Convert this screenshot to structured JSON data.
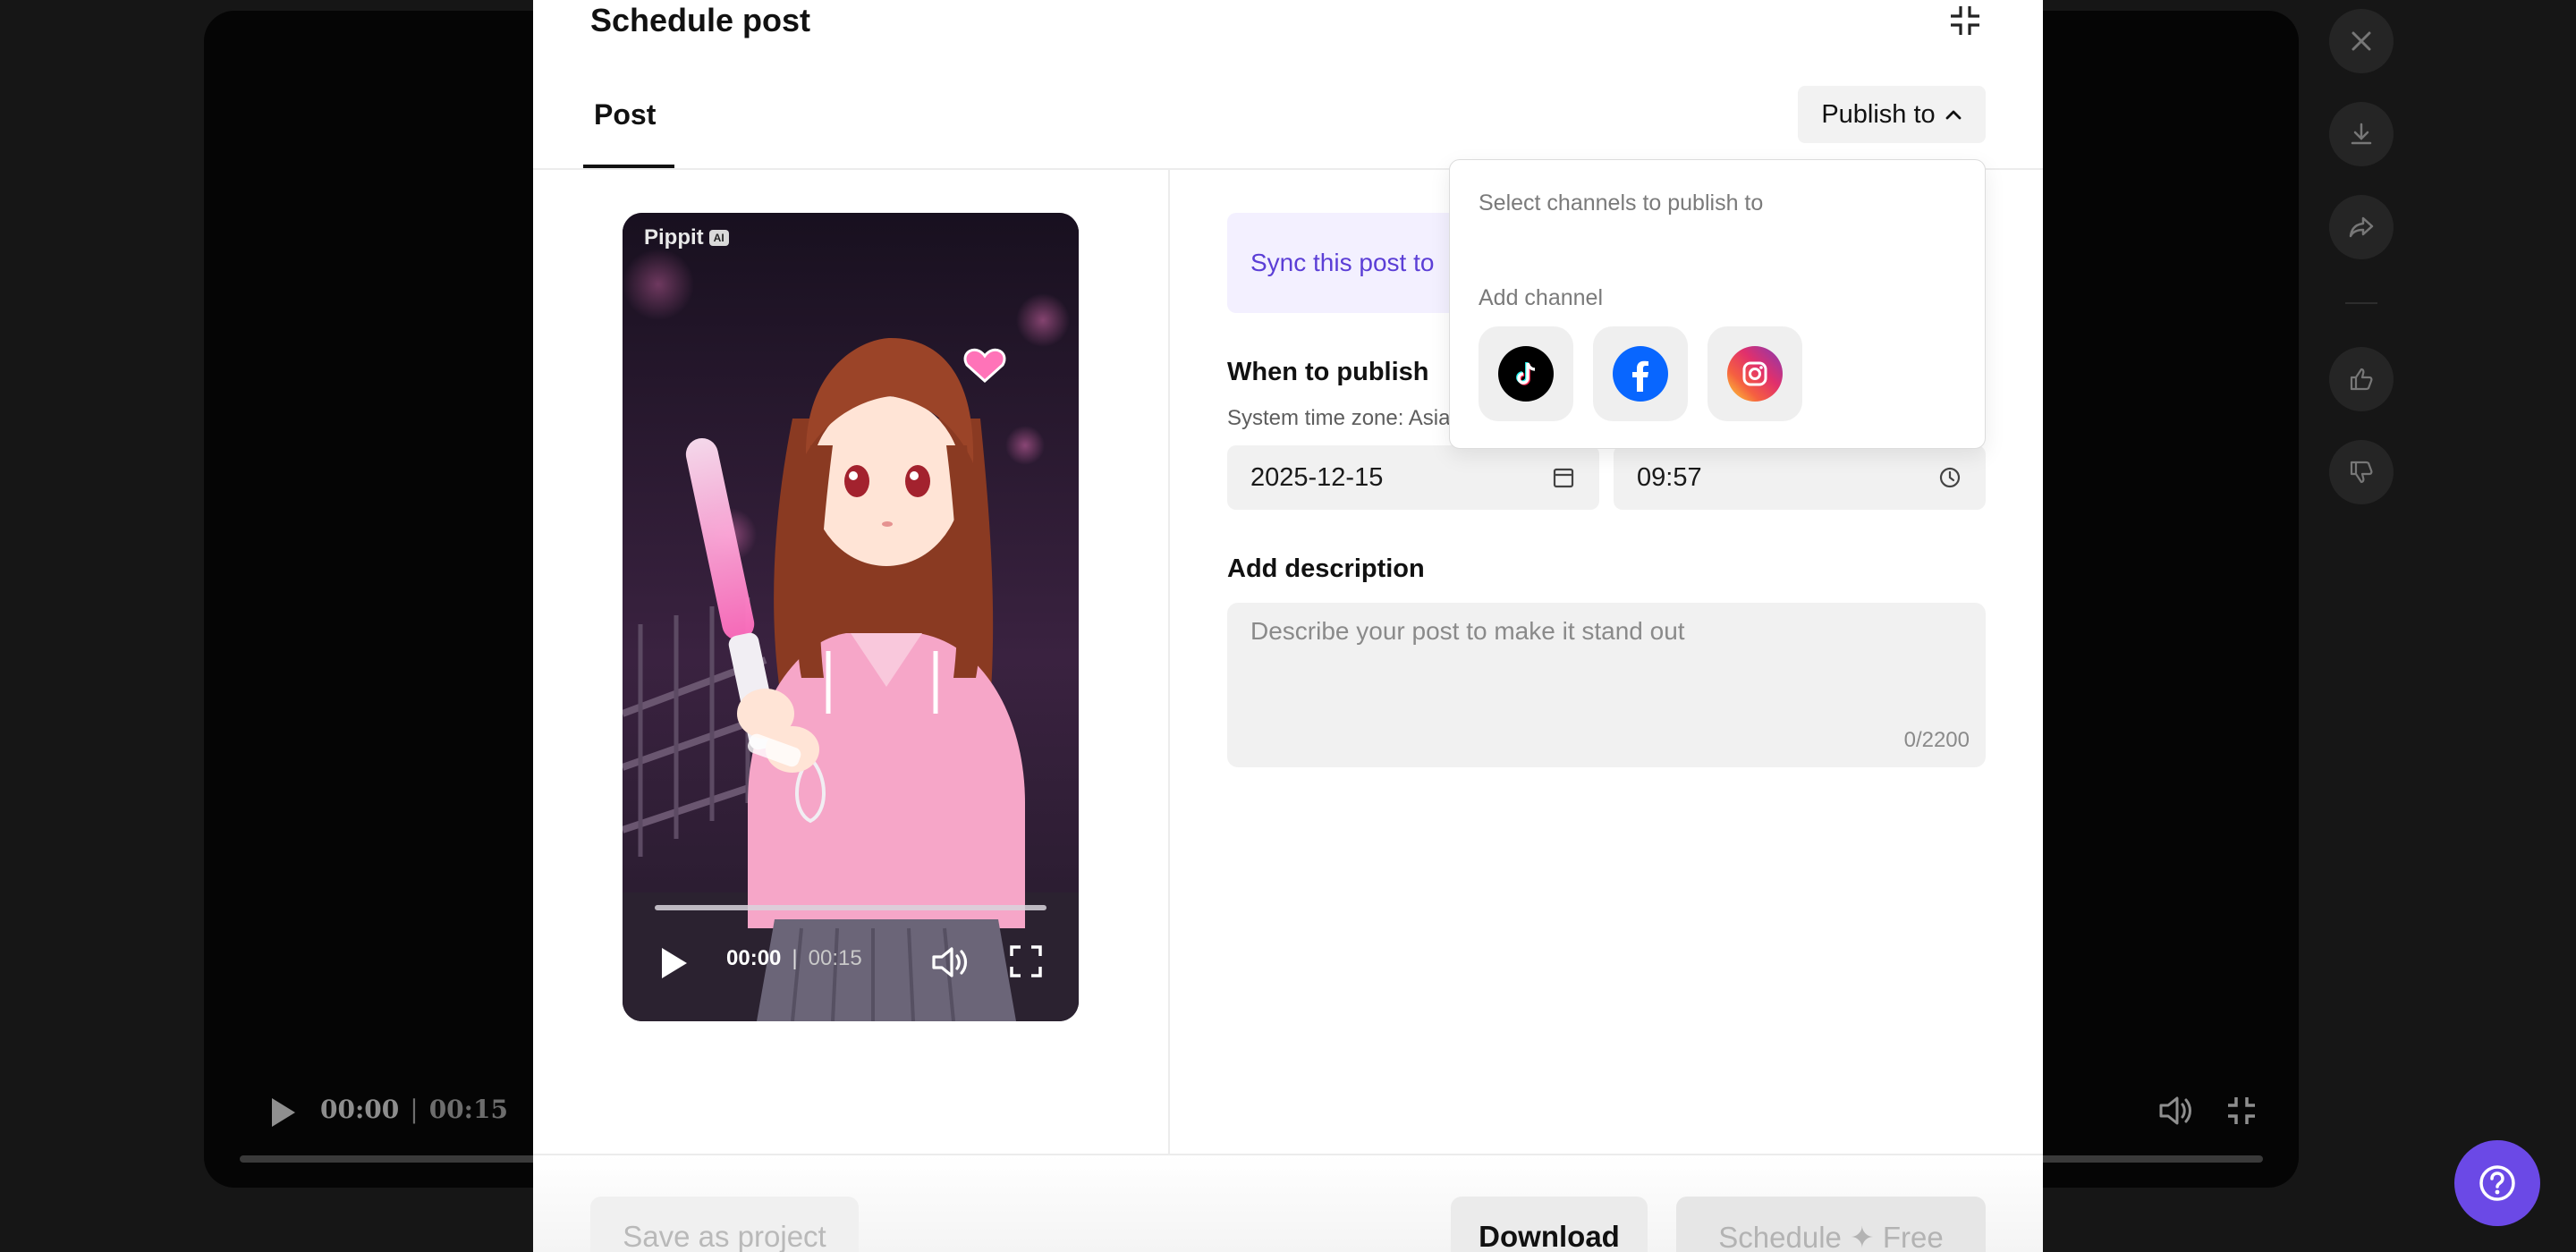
{
  "background_player": {
    "current_time": "00:00",
    "separator": "|",
    "duration": "00:15"
  },
  "modal": {
    "title": "Schedule post",
    "tabs": [
      {
        "label": "Post"
      }
    ],
    "publish_to_label": "Publish to",
    "video": {
      "watermark": "Pippit",
      "watermark_badge": "AI",
      "current_time": "00:00",
      "separator": "|",
      "duration": "00:15",
      "progress_fraction": 0
    },
    "sync_banner": "Sync this post to",
    "when_to_publish": {
      "label": "When to publish",
      "timezone_label": "System time zone: Asia",
      "date": "2025-12-15",
      "time": "09:57"
    },
    "description": {
      "label": "Add description",
      "placeholder": "Describe your post to make it stand out",
      "counter": "0/2200"
    },
    "dropdown": {
      "hint": "Select channels to publish to",
      "add_channel_label": "Add channel",
      "channels": [
        {
          "name": "TikTok",
          "icon": "tiktok-icon",
          "color": "#000000"
        },
        {
          "name": "Facebook",
          "icon": "facebook-icon",
          "color": "#0866ff"
        },
        {
          "name": "Instagram",
          "icon": "instagram-icon",
          "color": "#e1306c"
        }
      ]
    },
    "footer": {
      "save_label": "Save as project",
      "download_label": "Download",
      "schedule_label": "Schedule ✦ Free"
    }
  },
  "colors": {
    "accent_purple": "#6b49e6",
    "sync_text": "#5b3ed6",
    "sync_bg": "#f3f0ff"
  }
}
